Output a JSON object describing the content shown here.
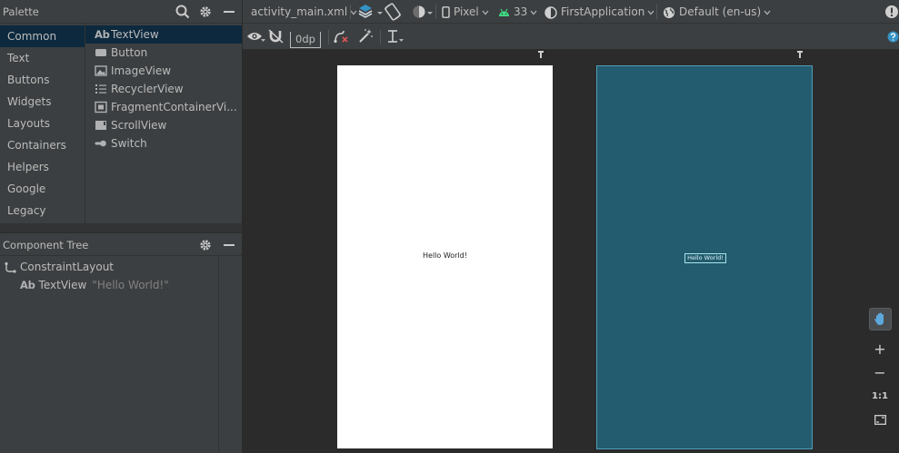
{
  "palette": {
    "title": "Palette",
    "categories": [
      "Common",
      "Text",
      "Buttons",
      "Widgets",
      "Layouts",
      "Containers",
      "Helpers",
      "Google",
      "Legacy"
    ],
    "items": [
      {
        "label": "TextView",
        "icon": "ab-icon"
      },
      {
        "label": "Button",
        "icon": "button-icon"
      },
      {
        "label": "ImageView",
        "icon": "image-icon"
      },
      {
        "label": "RecyclerView",
        "icon": "list-icon"
      },
      {
        "label": "FragmentContainerVi...",
        "icon": "fragment-icon"
      },
      {
        "label": "ScrollView",
        "icon": "scroll-icon"
      },
      {
        "label": "Switch",
        "icon": "switch-icon"
      }
    ],
    "selected_category": "Common",
    "selected_item": "TextView"
  },
  "component_tree": {
    "title": "Component Tree",
    "root": "ConstraintLayout",
    "child_icon_text": "Ab",
    "child_label": "TextView",
    "child_hint": "\"Hello World!\""
  },
  "toolbar": {
    "file": "activity_main.xml",
    "device": "Pixel",
    "api": "33",
    "theme": "FirstApplication",
    "locale": "Default (en-us)",
    "margin": "0dp"
  },
  "canvas": {
    "design_text": "Hello World!",
    "blueprint_text": "Hello World!"
  },
  "zoom": {
    "zoom_in": "+",
    "zoom_out": "−",
    "actual_size": "1:1"
  },
  "colors": {
    "panel": "#3c3f41",
    "selection": "#0d293e",
    "canvas": "#2b2b2b",
    "blueprint": "#235c6e",
    "accent_blue": "#3592c4",
    "android_green": "#3ddc84"
  }
}
